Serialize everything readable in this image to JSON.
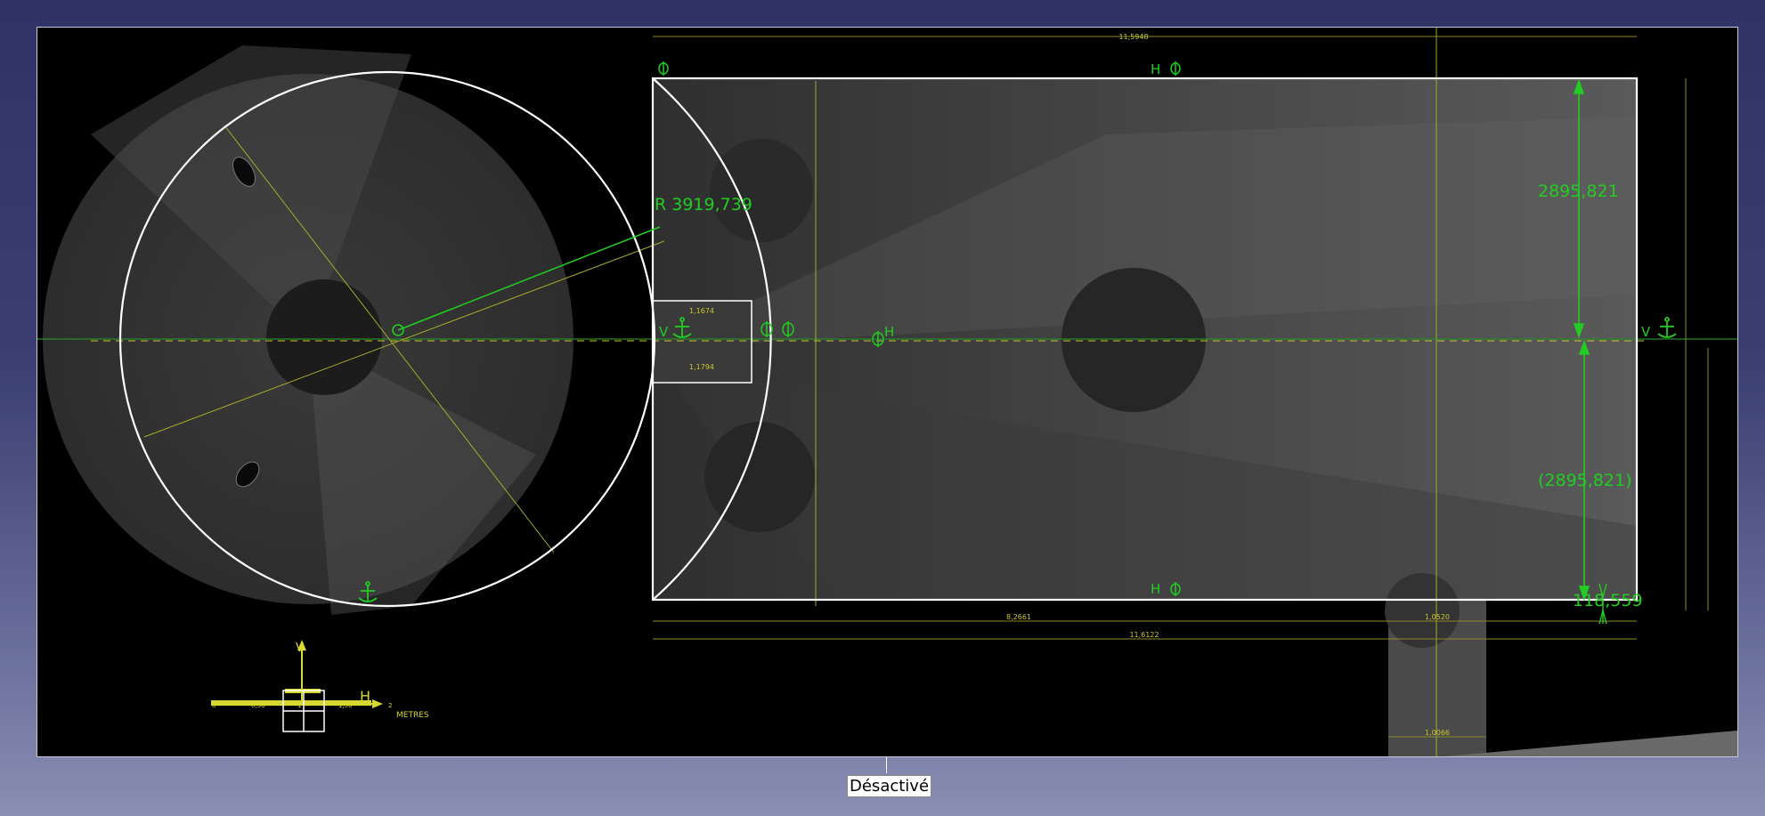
{
  "sketch": {
    "radius_label": "R 3919,739",
    "dim_top": "2895,821",
    "dim_bottom": "(2895,821)",
    "dim_small": "118,559",
    "constraint_h": "H",
    "constraint_v": "V",
    "scale_bar": {
      "axis_v": "V",
      "axis_h": "H",
      "ticks": [
        "0",
        "0,50",
        "1",
        "1,50",
        "2"
      ],
      "unit": "METRES"
    }
  },
  "status": {
    "label": "Désactivé"
  },
  "colors": {
    "geometry": "#ffffff",
    "dimension": "#22cc22",
    "reference": "#d8d832",
    "background": "#000000"
  }
}
